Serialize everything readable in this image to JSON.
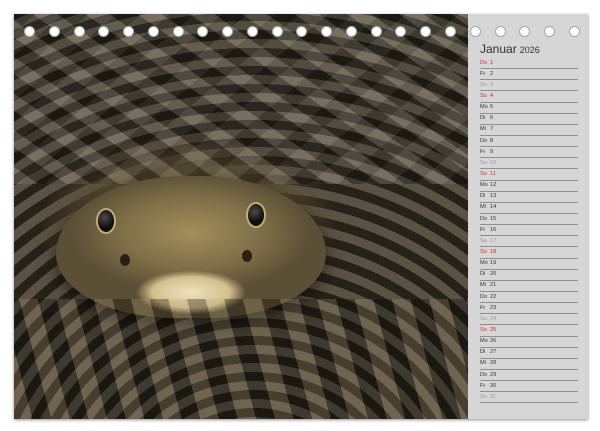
{
  "calendar": {
    "month": "Januar",
    "year": "2026",
    "days": [
      {
        "wd": "Do",
        "d": "1",
        "type": "holiday"
      },
      {
        "wd": "Fr",
        "d": "2",
        "type": "weekday"
      },
      {
        "wd": "Sa",
        "d": "3",
        "type": "sat"
      },
      {
        "wd": "So",
        "d": "4",
        "type": "sun"
      },
      {
        "wd": "Mo",
        "d": "5",
        "type": "weekday"
      },
      {
        "wd": "Di",
        "d": "6",
        "type": "weekday"
      },
      {
        "wd": "Mi",
        "d": "7",
        "type": "weekday"
      },
      {
        "wd": "Do",
        "d": "8",
        "type": "weekday"
      },
      {
        "wd": "Fr",
        "d": "9",
        "type": "weekday"
      },
      {
        "wd": "Sa",
        "d": "10",
        "type": "sat"
      },
      {
        "wd": "So",
        "d": "11",
        "type": "sun"
      },
      {
        "wd": "Mo",
        "d": "12",
        "type": "weekday"
      },
      {
        "wd": "Di",
        "d": "13",
        "type": "weekday"
      },
      {
        "wd": "Mi",
        "d": "14",
        "type": "weekday"
      },
      {
        "wd": "Do",
        "d": "15",
        "type": "weekday"
      },
      {
        "wd": "Fr",
        "d": "16",
        "type": "weekday"
      },
      {
        "wd": "Sa",
        "d": "17",
        "type": "sat"
      },
      {
        "wd": "So",
        "d": "18",
        "type": "sun"
      },
      {
        "wd": "Mo",
        "d": "19",
        "type": "weekday"
      },
      {
        "wd": "Di",
        "d": "20",
        "type": "weekday"
      },
      {
        "wd": "Mi",
        "d": "21",
        "type": "weekday"
      },
      {
        "wd": "Do",
        "d": "22",
        "type": "weekday"
      },
      {
        "wd": "Fr",
        "d": "23",
        "type": "weekday"
      },
      {
        "wd": "Sa",
        "d": "24",
        "type": "sat"
      },
      {
        "wd": "So",
        "d": "25",
        "type": "sun"
      },
      {
        "wd": "Mo",
        "d": "26",
        "type": "weekday"
      },
      {
        "wd": "Di",
        "d": "27",
        "type": "weekday"
      },
      {
        "wd": "Mi",
        "d": "28",
        "type": "weekday"
      },
      {
        "wd": "Do",
        "d": "29",
        "type": "weekday"
      },
      {
        "wd": "Fr",
        "d": "30",
        "type": "weekday"
      },
      {
        "wd": "Sa",
        "d": "31",
        "type": "sat"
      }
    ]
  },
  "binding": {
    "hole_count": 23
  },
  "photo": {
    "subject_icon": "snake-photo"
  },
  "colors": {
    "panel": "#d6d6d6",
    "sunday_red": "#d9232d",
    "saturday_gray": "#9a9a9a",
    "text": "#333333"
  }
}
